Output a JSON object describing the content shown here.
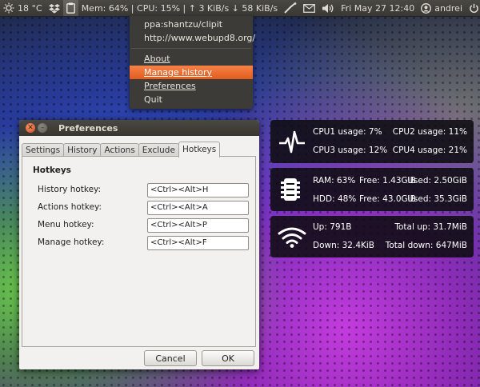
{
  "panel": {
    "temperature": "18 °C",
    "system_monitor": "Mem: 64% | CPU: 15% | ↑ 3 KiB/s ↓ 58 KiB/s",
    "datetime": "Fri May 27 12:40",
    "user": "andrei"
  },
  "clipit_menu": {
    "history_items": [
      "ppa:shantzu/clipit",
      "http://www.webupd8.org/"
    ],
    "about": "About",
    "manage_history": "Manage history",
    "preferences": "Preferences",
    "quit": "Quit"
  },
  "preferences_window": {
    "title": "Preferences",
    "tabs": [
      "Settings",
      "History",
      "Actions",
      "Exclude",
      "Hotkeys"
    ],
    "active_tab": "Hotkeys",
    "section_title": "Hotkeys",
    "hotkeys": [
      {
        "label": "History hotkey:",
        "value": "<Ctrl><Alt>H"
      },
      {
        "label": "Actions hotkey:",
        "value": "<Ctrl><Alt>A"
      },
      {
        "label": "Menu hotkey:",
        "value": "<Ctrl><Alt>P"
      },
      {
        "label": "Manage hotkey:",
        "value": "<Ctrl><Alt>F"
      }
    ],
    "cancel_label": "Cancel",
    "ok_label": "OK"
  },
  "conky": {
    "cpu": {
      "cpu1": "CPU1 usage: 7%",
      "cpu2": "CPU2 usage: 11%",
      "cpu3": "CPU3 usage: 12%",
      "cpu4": "CPU4 usage: 21%"
    },
    "memory": {
      "ram": "RAM: 63%",
      "ram_free": "Free: 1.43GiB",
      "ram_used": "Used: 2.50GiB",
      "hdd": "HDD: 48%",
      "hdd_free": "Free: 43.0GiB",
      "hdd_used": "Used: 35.3GiB"
    },
    "network": {
      "up": "Up: 791B",
      "total_up": "Total up: 31.7MiB",
      "down": "Down: 32.4KiB",
      "total_down": "Total down: 647MiB"
    }
  },
  "icons": {
    "weather": "weather-sun-icon",
    "dropbox": "dropbox-icon",
    "clipit": "clipboard-icon",
    "network": "network-icon",
    "mail": "mail-icon",
    "volume": "volume-icon",
    "user": "user-icon",
    "power": "power-icon",
    "cpu": "heartbeat-icon",
    "memory": "memory-chip-icon",
    "wifi": "wifi-icon"
  }
}
